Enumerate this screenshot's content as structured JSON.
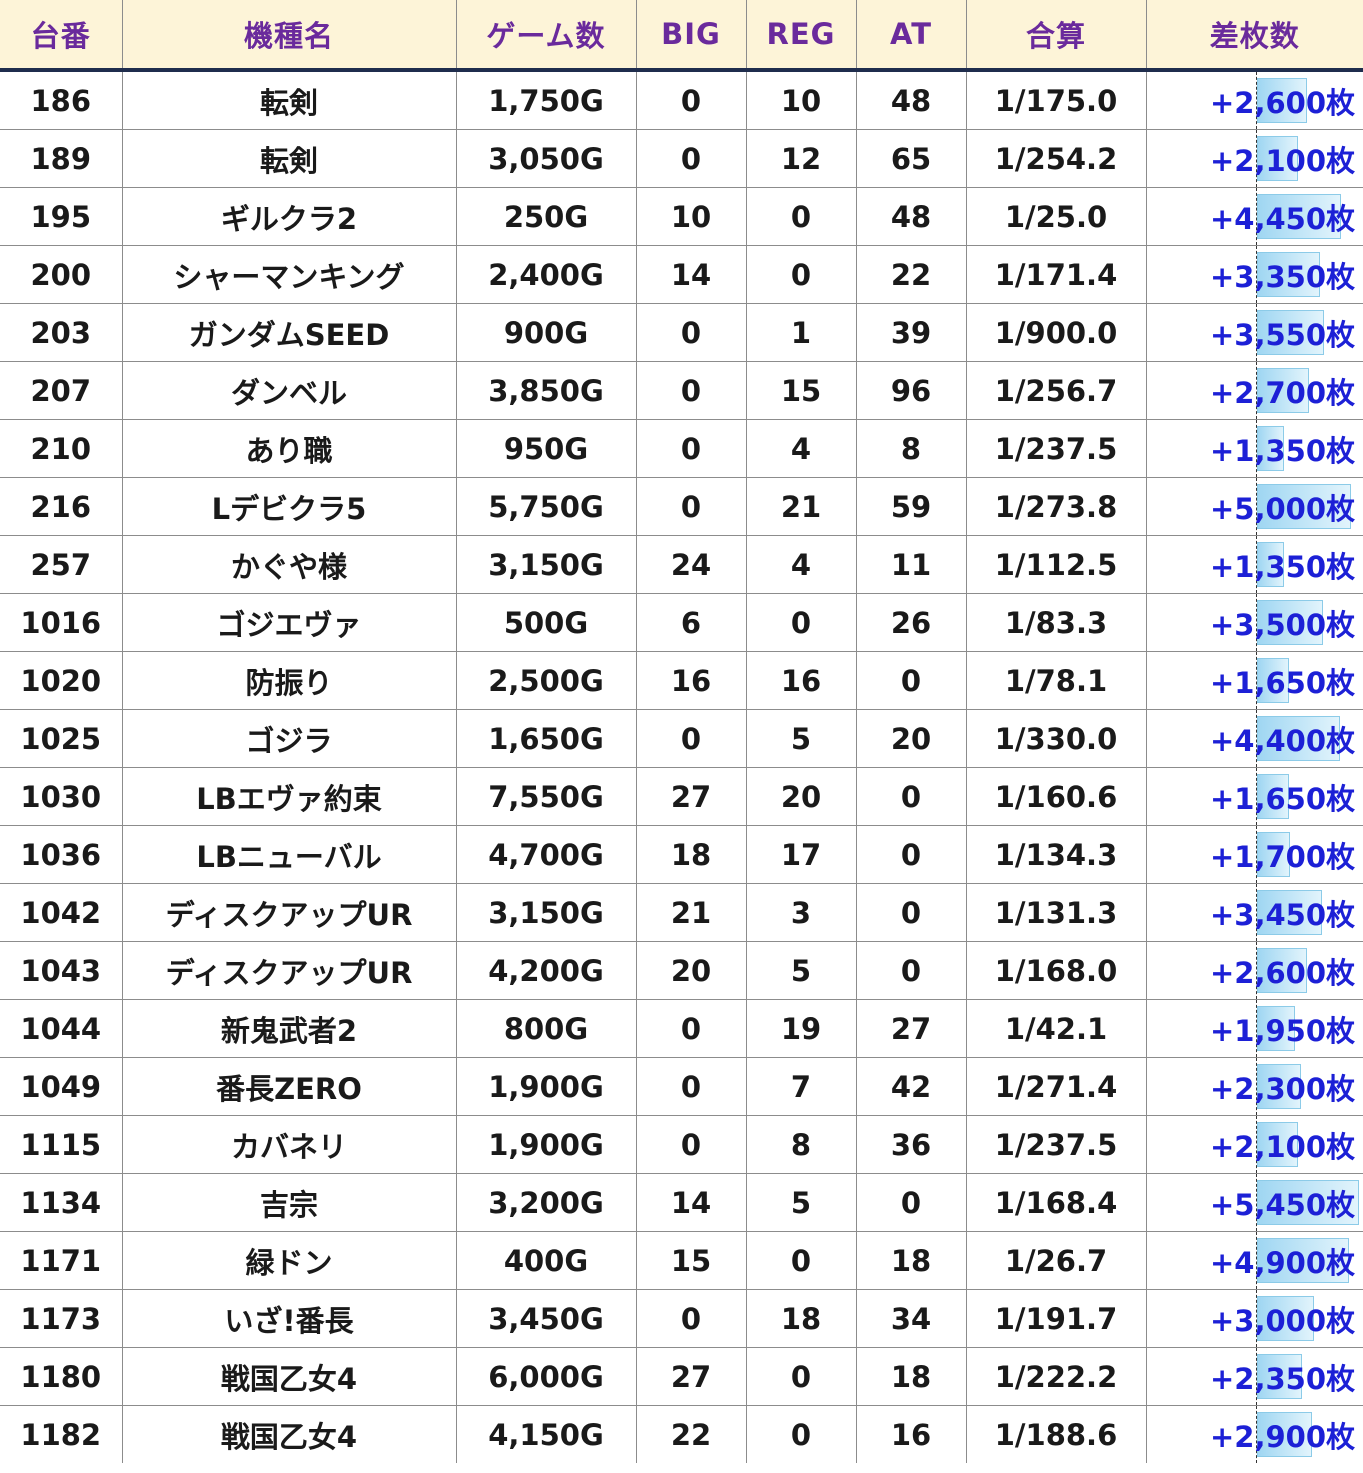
{
  "table": {
    "headers": [
      "台番",
      "機種名",
      "ゲーム数",
      "BIG",
      "REG",
      "AT",
      "合算",
      "差枚数"
    ],
    "max_diff": 5450,
    "rows": [
      {
        "id": "186",
        "name": "転剣",
        "games": "1,750G",
        "big": "0",
        "reg": "10",
        "at": "48",
        "combined": "1/175.0",
        "diff": "+2,600枚",
        "diff_value": 2600
      },
      {
        "id": "189",
        "name": "転剣",
        "games": "3,050G",
        "big": "0",
        "reg": "12",
        "at": "65",
        "combined": "1/254.2",
        "diff": "+2,100枚",
        "diff_value": 2100
      },
      {
        "id": "195",
        "name": "ギルクラ2",
        "games": "250G",
        "big": "10",
        "reg": "0",
        "at": "48",
        "combined": "1/25.0",
        "diff": "+4,450枚",
        "diff_value": 4450
      },
      {
        "id": "200",
        "name": "シャーマンキング",
        "games": "2,400G",
        "big": "14",
        "reg": "0",
        "at": "22",
        "combined": "1/171.4",
        "diff": "+3,350枚",
        "diff_value": 3350
      },
      {
        "id": "203",
        "name": "ガンダムSEED",
        "games": "900G",
        "big": "0",
        "reg": "1",
        "at": "39",
        "combined": "1/900.0",
        "diff": "+3,550枚",
        "diff_value": 3550
      },
      {
        "id": "207",
        "name": "ダンベル",
        "games": "3,850G",
        "big": "0",
        "reg": "15",
        "at": "96",
        "combined": "1/256.7",
        "diff": "+2,700枚",
        "diff_value": 2700
      },
      {
        "id": "210",
        "name": "あり職",
        "games": "950G",
        "big": "0",
        "reg": "4",
        "at": "8",
        "combined": "1/237.5",
        "diff": "+1,350枚",
        "diff_value": 1350
      },
      {
        "id": "216",
        "name": "Lデビクラ5",
        "games": "5,750G",
        "big": "0",
        "reg": "21",
        "at": "59",
        "combined": "1/273.8",
        "diff": "+5,000枚",
        "diff_value": 5000
      },
      {
        "id": "257",
        "name": "かぐや様",
        "games": "3,150G",
        "big": "24",
        "reg": "4",
        "at": "11",
        "combined": "1/112.5",
        "diff": "+1,350枚",
        "diff_value": 1350
      },
      {
        "id": "1016",
        "name": "ゴジエヴァ",
        "games": "500G",
        "big": "6",
        "reg": "0",
        "at": "26",
        "combined": "1/83.3",
        "diff": "+3,500枚",
        "diff_value": 3500
      },
      {
        "id": "1020",
        "name": "防振り",
        "games": "2,500G",
        "big": "16",
        "reg": "16",
        "at": "0",
        "combined": "1/78.1",
        "diff": "+1,650枚",
        "diff_value": 1650
      },
      {
        "id": "1025",
        "name": "ゴジラ",
        "games": "1,650G",
        "big": "0",
        "reg": "5",
        "at": "20",
        "combined": "1/330.0",
        "diff": "+4,400枚",
        "diff_value": 4400
      },
      {
        "id": "1030",
        "name": "LBエヴァ約束",
        "games": "7,550G",
        "big": "27",
        "reg": "20",
        "at": "0",
        "combined": "1/160.6",
        "diff": "+1,650枚",
        "diff_value": 1650
      },
      {
        "id": "1036",
        "name": "LBニューバル",
        "games": "4,700G",
        "big": "18",
        "reg": "17",
        "at": "0",
        "combined": "1/134.3",
        "diff": "+1,700枚",
        "diff_value": 1700
      },
      {
        "id": "1042",
        "name": "ディスクアップUR",
        "games": "3,150G",
        "big": "21",
        "reg": "3",
        "at": "0",
        "combined": "1/131.3",
        "diff": "+3,450枚",
        "diff_value": 3450
      },
      {
        "id": "1043",
        "name": "ディスクアップUR",
        "games": "4,200G",
        "big": "20",
        "reg": "5",
        "at": "0",
        "combined": "1/168.0",
        "diff": "+2,600枚",
        "diff_value": 2600
      },
      {
        "id": "1044",
        "name": "新鬼武者2",
        "games": "800G",
        "big": "0",
        "reg": "19",
        "at": "27",
        "combined": "1/42.1",
        "diff": "+1,950枚",
        "diff_value": 1950
      },
      {
        "id": "1049",
        "name": "番長ZERO",
        "games": "1,900G",
        "big": "0",
        "reg": "7",
        "at": "42",
        "combined": "1/271.4",
        "diff": "+2,300枚",
        "diff_value": 2300
      },
      {
        "id": "1115",
        "name": "カバネリ",
        "games": "1,900G",
        "big": "0",
        "reg": "8",
        "at": "36",
        "combined": "1/237.5",
        "diff": "+2,100枚",
        "diff_value": 2100
      },
      {
        "id": "1134",
        "name": "吉宗",
        "games": "3,200G",
        "big": "14",
        "reg": "5",
        "at": "0",
        "combined": "1/168.4",
        "diff": "+5,450枚",
        "diff_value": 5450
      },
      {
        "id": "1171",
        "name": "緑ドン",
        "games": "400G",
        "big": "15",
        "reg": "0",
        "at": "18",
        "combined": "1/26.7",
        "diff": "+4,900枚",
        "diff_value": 4900
      },
      {
        "id": "1173",
        "name": "いざ!番長",
        "games": "3,450G",
        "big": "0",
        "reg": "18",
        "at": "34",
        "combined": "1/191.7",
        "diff": "+3,000枚",
        "diff_value": 3000
      },
      {
        "id": "1180",
        "name": "戦国乙女4",
        "games": "6,000G",
        "big": "27",
        "reg": "0",
        "at": "18",
        "combined": "1/222.2",
        "diff": "+2,350枚",
        "diff_value": 2350
      },
      {
        "id": "1182",
        "name": "戦国乙女4",
        "games": "4,150G",
        "big": "22",
        "reg": "0",
        "at": "16",
        "combined": "1/188.6",
        "diff": "+2,900枚",
        "diff_value": 2900
      }
    ]
  }
}
